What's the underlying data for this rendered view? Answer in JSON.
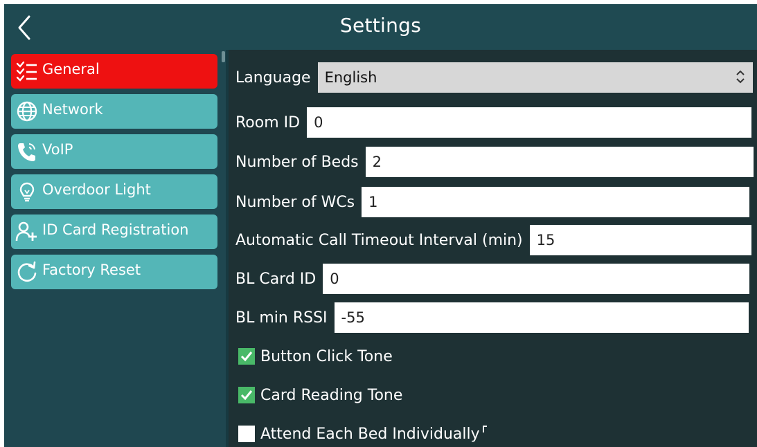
{
  "header": {
    "title": "Settings",
    "back_icon": "chevron-left-icon"
  },
  "sidebar": {
    "items": [
      {
        "label": "General",
        "icon": "checklist-icon",
        "active": true
      },
      {
        "label": "Network",
        "icon": "globe-icon",
        "active": false
      },
      {
        "label": "VoIP",
        "icon": "phone-call-icon",
        "active": false
      },
      {
        "label": "Overdoor Light",
        "icon": "lightbulb-icon",
        "active": false
      },
      {
        "label": "ID Card Registration",
        "icon": "add-user-icon",
        "active": false
      },
      {
        "label": "Factory Reset",
        "icon": "reset-icon",
        "active": false
      }
    ]
  },
  "form": {
    "language": {
      "label": "Language",
      "value": "English"
    },
    "room_id": {
      "label": "Room ID",
      "value": "0"
    },
    "beds": {
      "label": "Number of Beds",
      "value": "2"
    },
    "wcs": {
      "label": "Number of WCs",
      "value": "1"
    },
    "timeout": {
      "label": "Automatic Call Timeout Interval (min)",
      "value": "15"
    },
    "bl_card_id": {
      "label": "BL Card ID",
      "value": "0"
    },
    "bl_min_rssi": {
      "label": "BL min RSSI",
      "value": "-55"
    },
    "checkboxes": [
      {
        "label": "Button Click Tone",
        "checked": true
      },
      {
        "label": "Card Reading Tone",
        "checked": true
      },
      {
        "label": "Attend Each Bed Individually",
        "checked": false
      }
    ]
  },
  "colors": {
    "topbar": "#1f4a52",
    "sidebar_item": "#54b6b7",
    "active_item": "#ee1111",
    "content_bg": "#1e3134",
    "checkbox_on": "#49b968"
  }
}
